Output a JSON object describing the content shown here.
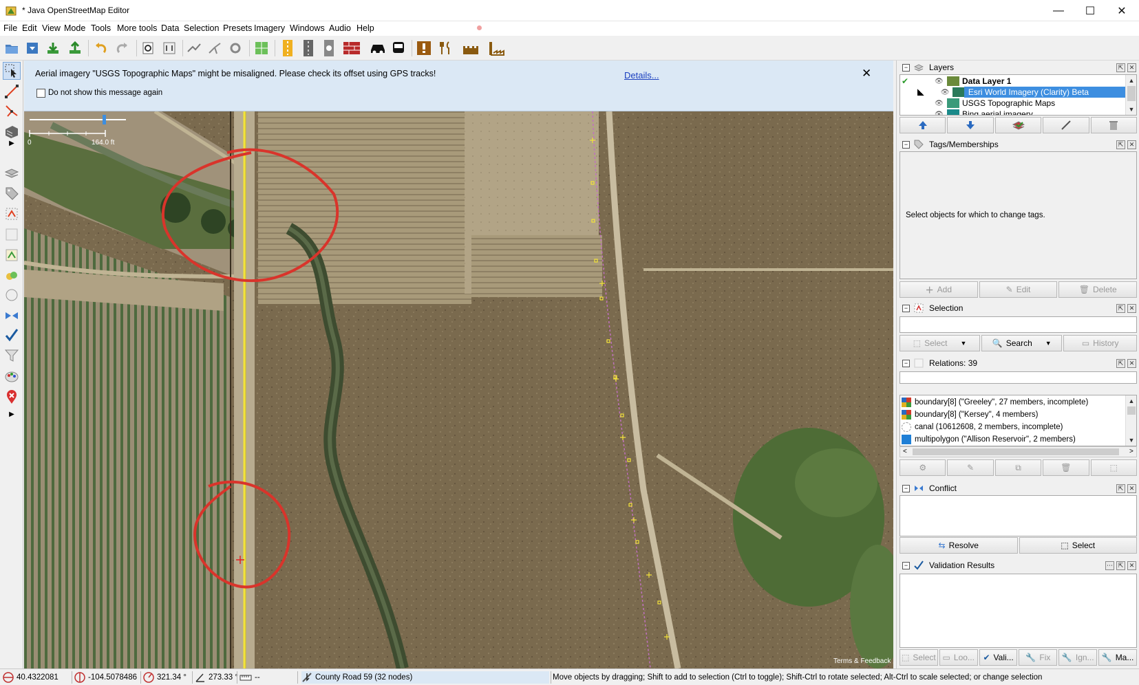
{
  "window": {
    "title": "* Java OpenStreetMap Editor",
    "minimize": "—",
    "maximize": "☐",
    "close": "✕"
  },
  "menu": [
    "File",
    "Edit",
    "View",
    "Mode",
    "Tools",
    "More tools",
    "Data",
    "Selection",
    "Presets",
    "Imagery",
    "Windows",
    "Audio",
    "Help"
  ],
  "notice": {
    "message": "Aerial imagery \"USGS Topographic Maps\" might be misaligned. Please check its offset using GPS tracks!",
    "details_link": "Details...",
    "checkbox_label": "Do not show this message again",
    "close_glyph": "✕"
  },
  "map": {
    "scale_start": "0",
    "scale_end": "164.0 ft",
    "attribution": "Terms & Feedback"
  },
  "status": {
    "lat": "40.4322081",
    "lon": "-104.5078486",
    "heading": "321.34 °",
    "angle": "273.33 °",
    "distance": "--",
    "selected_way": "County Road 59 (32 nodes)",
    "help": "Move objects by dragging; Shift to add to selection (Ctrl to toggle); Shift-Ctrl to rotate selected; Alt-Ctrl to scale selected; or change selection"
  },
  "panels": {
    "layers": {
      "title": "Layers",
      "rows": [
        {
          "label": "Data Layer 1",
          "bold": true,
          "selected": false
        },
        {
          "label": "Esri World Imagery (Clarity) Beta",
          "bold": false,
          "selected": true
        },
        {
          "label": "USGS Topographic Maps",
          "bold": false,
          "selected": false
        },
        {
          "label": "Bing aerial imagery",
          "bold": false,
          "selected": false
        }
      ]
    },
    "tags": {
      "title": "Tags/Memberships",
      "empty_text": "Select objects for which to change tags.",
      "btn_add": "Add",
      "btn_edit": "Edit",
      "btn_delete": "Delete"
    },
    "selection": {
      "title": "Selection",
      "btn_select": "Select",
      "btn_search": "Search",
      "btn_history": "History"
    },
    "relations": {
      "title": "Relations: 39",
      "rows": [
        {
          "label": "boundary[8] (\"Greeley\", 27 members, incomplete)",
          "icon_color": "#d03a2a"
        },
        {
          "label": "boundary[8] (\"Kersey\", 4 members)",
          "icon_color": "#d03a2a"
        },
        {
          "label": "canal (10612608, 2 members, incomplete)",
          "icon_color": "#bbbbbb"
        },
        {
          "label": "multipolygon (\"Allison Reservoir\", 2 members)",
          "icon_color": "#1f7fd6"
        }
      ]
    },
    "conflict": {
      "title": "Conflict",
      "btn_resolve": "Resolve",
      "btn_select": "Select"
    },
    "validation": {
      "title": "Validation Results",
      "tabs": [
        "Select",
        "Loo...",
        "Vali...",
        "Fix",
        "Ign...",
        "Ma..."
      ]
    }
  },
  "colors": {
    "notice_bg": "#dbe8f5",
    "selection_blue": "#3d8ee0",
    "annotation_red": "#d9342b",
    "road_yellow": "#f3e33a"
  }
}
